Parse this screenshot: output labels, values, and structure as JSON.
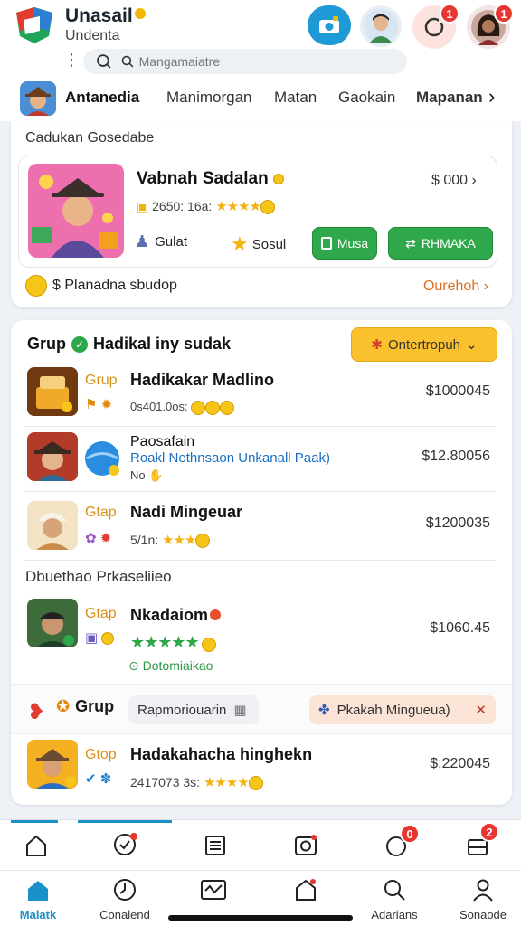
{
  "header": {
    "app_title": "Unasail",
    "app_subtitle": "Undenta",
    "search_placeholder": "Mangamaiatre",
    "bell_badge": "1",
    "user_badge": "1"
  },
  "categories": {
    "active": "Antanedia",
    "tabs": [
      "Manimorgan",
      "Matan",
      "Gaokain",
      "Mapanan"
    ]
  },
  "section1": {
    "title": "Cadukan Gosedabe",
    "feature": {
      "name": "Vabnah Sadalan",
      "meta": "2650: 16a:",
      "price": "$ 000",
      "action1": "Gulat",
      "action2": "Sosul",
      "button1": "Musa",
      "button2": "RHMAKA"
    },
    "footer_left": "$ Planadna sbudop",
    "footer_right": "Ourehoh"
  },
  "section2": {
    "title": "Grup",
    "title_rest": "Hadikal iny sudak",
    "dropdown": "Ontertropuh",
    "rows": [
      {
        "tag": "Grup",
        "name": "Hadikakar Madlino",
        "meta": "0s401.0os:",
        "price": "$1000045"
      },
      {
        "tag": "",
        "name": "Paosafain",
        "meta": "Roakl Nethnsaon Unkanall Paak)",
        "meta2": "No",
        "price": "$12.80056"
      },
      {
        "tag": "Gtap",
        "name": "Nadi Mingeuar",
        "meta": "5/1n:",
        "price": "$1200035"
      }
    ],
    "subsection_title": "Dbuethao Prkaseliieo",
    "row4": {
      "tag": "Gtap",
      "name": "Nkadaiom",
      "meta": "Dotomiaikao",
      "price": "$1060.45"
    },
    "toolbar": {
      "label": "Grup",
      "chip1": "Rapmoriouarin",
      "chip2": "Pkakah Mingueua)"
    },
    "row5": {
      "tag": "Gtop",
      "name": "Hadakahacha hinghekn",
      "meta": "2417073 3s:",
      "price": "$:220045"
    }
  },
  "bottom_nav": {
    "items": [
      "Malatk",
      "Conalend",
      "",
      "",
      "Adarians",
      "Sonaode"
    ],
    "badge1": "0",
    "badge2": "2"
  }
}
